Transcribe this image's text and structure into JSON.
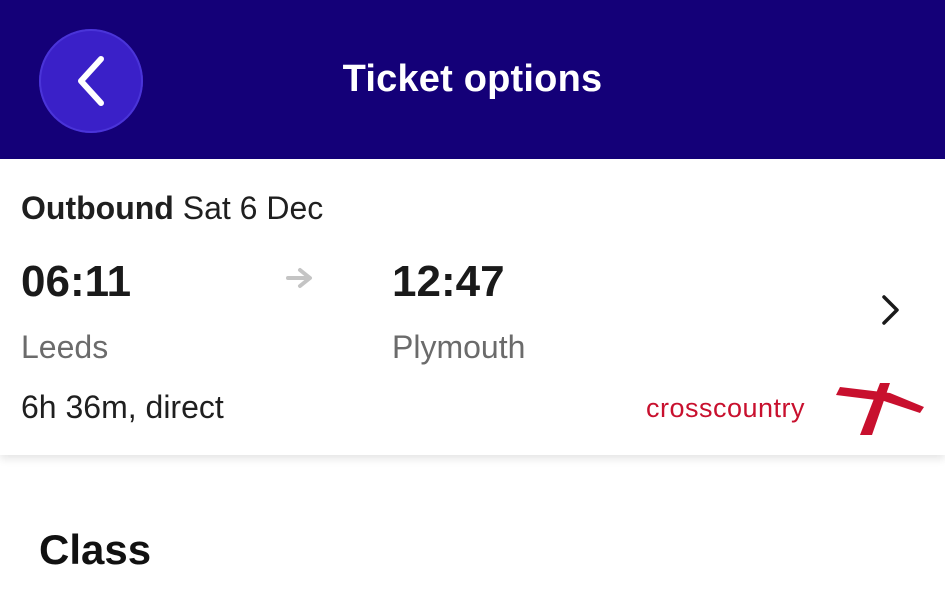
{
  "header": {
    "title": "Ticket options",
    "background_color": "#140078",
    "back_button_color": "#3a20c8",
    "back_icon": "chevron-left-icon"
  },
  "journey": {
    "direction_label": "Outbound",
    "date": "Sat 6 Dec",
    "depart_time": "06:11",
    "arrive_time": "12:47",
    "origin": "Leeds",
    "destination": "Plymouth",
    "duration": "6h 36m, direct",
    "operator": "crosscountry",
    "operator_color": "#c8102e",
    "arrow_icon": "arrow-right-icon",
    "chevron_icon": "chevron-right-icon"
  },
  "section": {
    "heading": "Class"
  }
}
